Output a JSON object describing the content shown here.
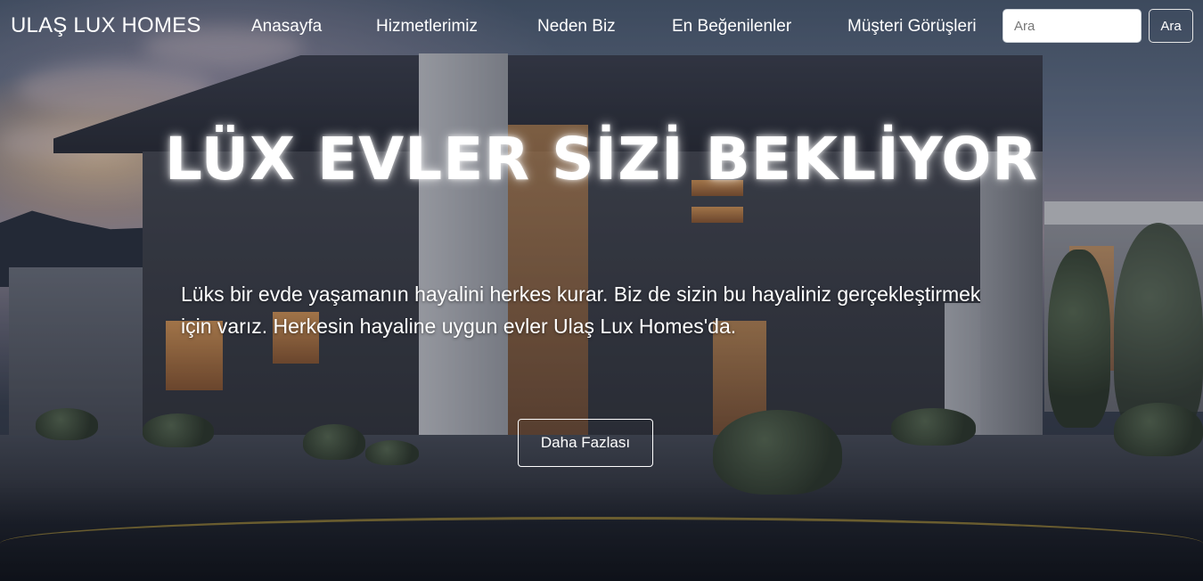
{
  "navbar": {
    "brand": "ULAŞ LUX HOMES",
    "links": [
      "Anasayfa",
      "Hizmetlerimiz",
      "Neden Biz",
      "En Beğenilenler",
      "Müşteri Görüşleri"
    ],
    "search": {
      "placeholder": "Ara",
      "value": "",
      "button_label": "Ara"
    }
  },
  "hero": {
    "title": "LÜX EVLER SİZİ BEKLİYOR",
    "description": "Lüks bir evde yaşamanın hayalini herkes kurar. Biz de sizin bu hayaliniz gerçekleştirmek için varız. Herkesin hayaline uygun evler Ulaş Lux Homes'da.",
    "button_label": "Daha Fazlası"
  },
  "colors": {
    "text": "#ffffff",
    "input_background": "#ffffff",
    "button_border": "#ffffff"
  }
}
